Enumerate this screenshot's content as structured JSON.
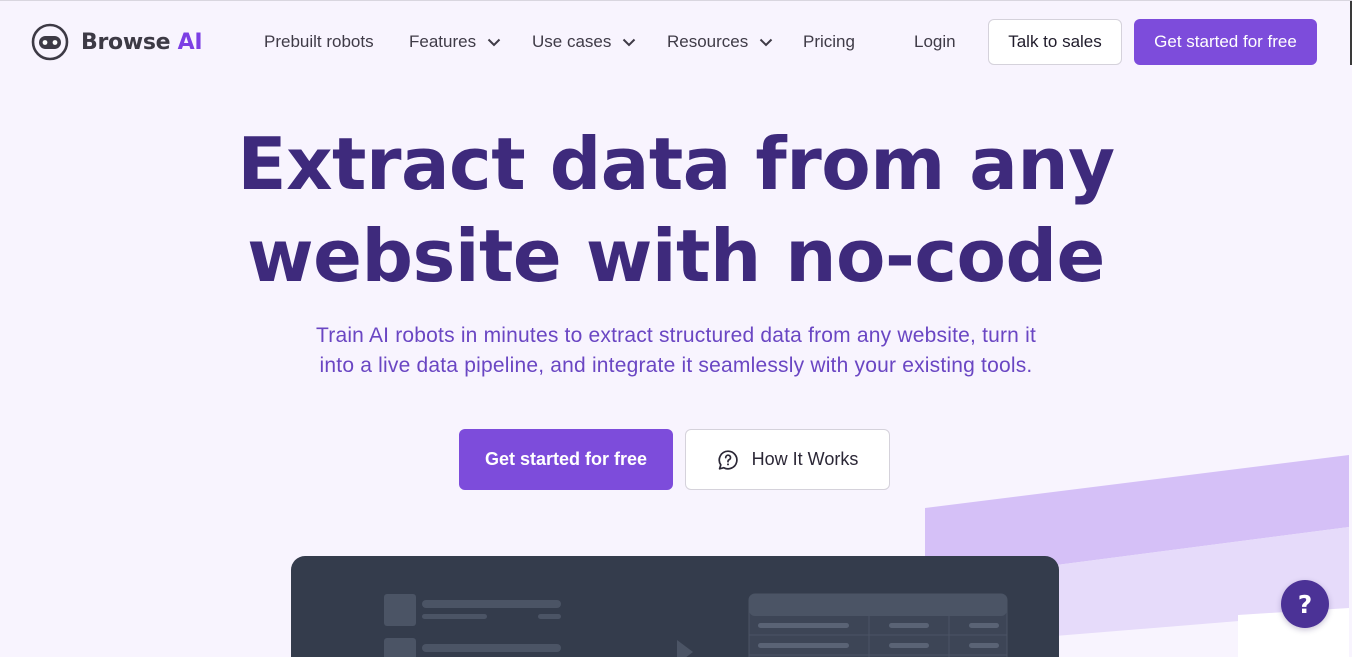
{
  "brand": {
    "name_main": "Browse",
    "name_accent": "AI",
    "accent_color": "#7c3fe4"
  },
  "nav": {
    "links": [
      {
        "label": "Prebuilt robots",
        "has_dropdown": false
      },
      {
        "label": "Features",
        "has_dropdown": true
      },
      {
        "label": "Use cases",
        "has_dropdown": true
      },
      {
        "label": "Resources",
        "has_dropdown": true
      },
      {
        "label": "Pricing",
        "has_dropdown": false
      },
      {
        "label": "Login",
        "has_dropdown": false
      }
    ],
    "talk_to_sales": "Talk to sales",
    "get_started": "Get started for free"
  },
  "hero": {
    "title_line1": "Extract data from any",
    "title_line2": "website with no-code",
    "subtitle_line1": "Train AI robots in minutes to extract structured data from any website, turn it",
    "subtitle_line2": "into a live data pipeline, and integrate it seamlessly with your existing tools.",
    "cta_primary": "Get started for free",
    "cta_secondary": "How It Works"
  },
  "help": {
    "label": "?"
  },
  "colors": {
    "background": "#f8f4fe",
    "primary_button": "#7d4cdb",
    "title_text": "#3e2a7c",
    "subtitle_text": "#6a46c3",
    "help_button": "#4b3296",
    "mockup_bg": "#343c4c"
  },
  "icons": {
    "logo": "robot-face-icon",
    "dropdown": "chevron-down-icon",
    "how_it_works": "chat-question-icon"
  }
}
